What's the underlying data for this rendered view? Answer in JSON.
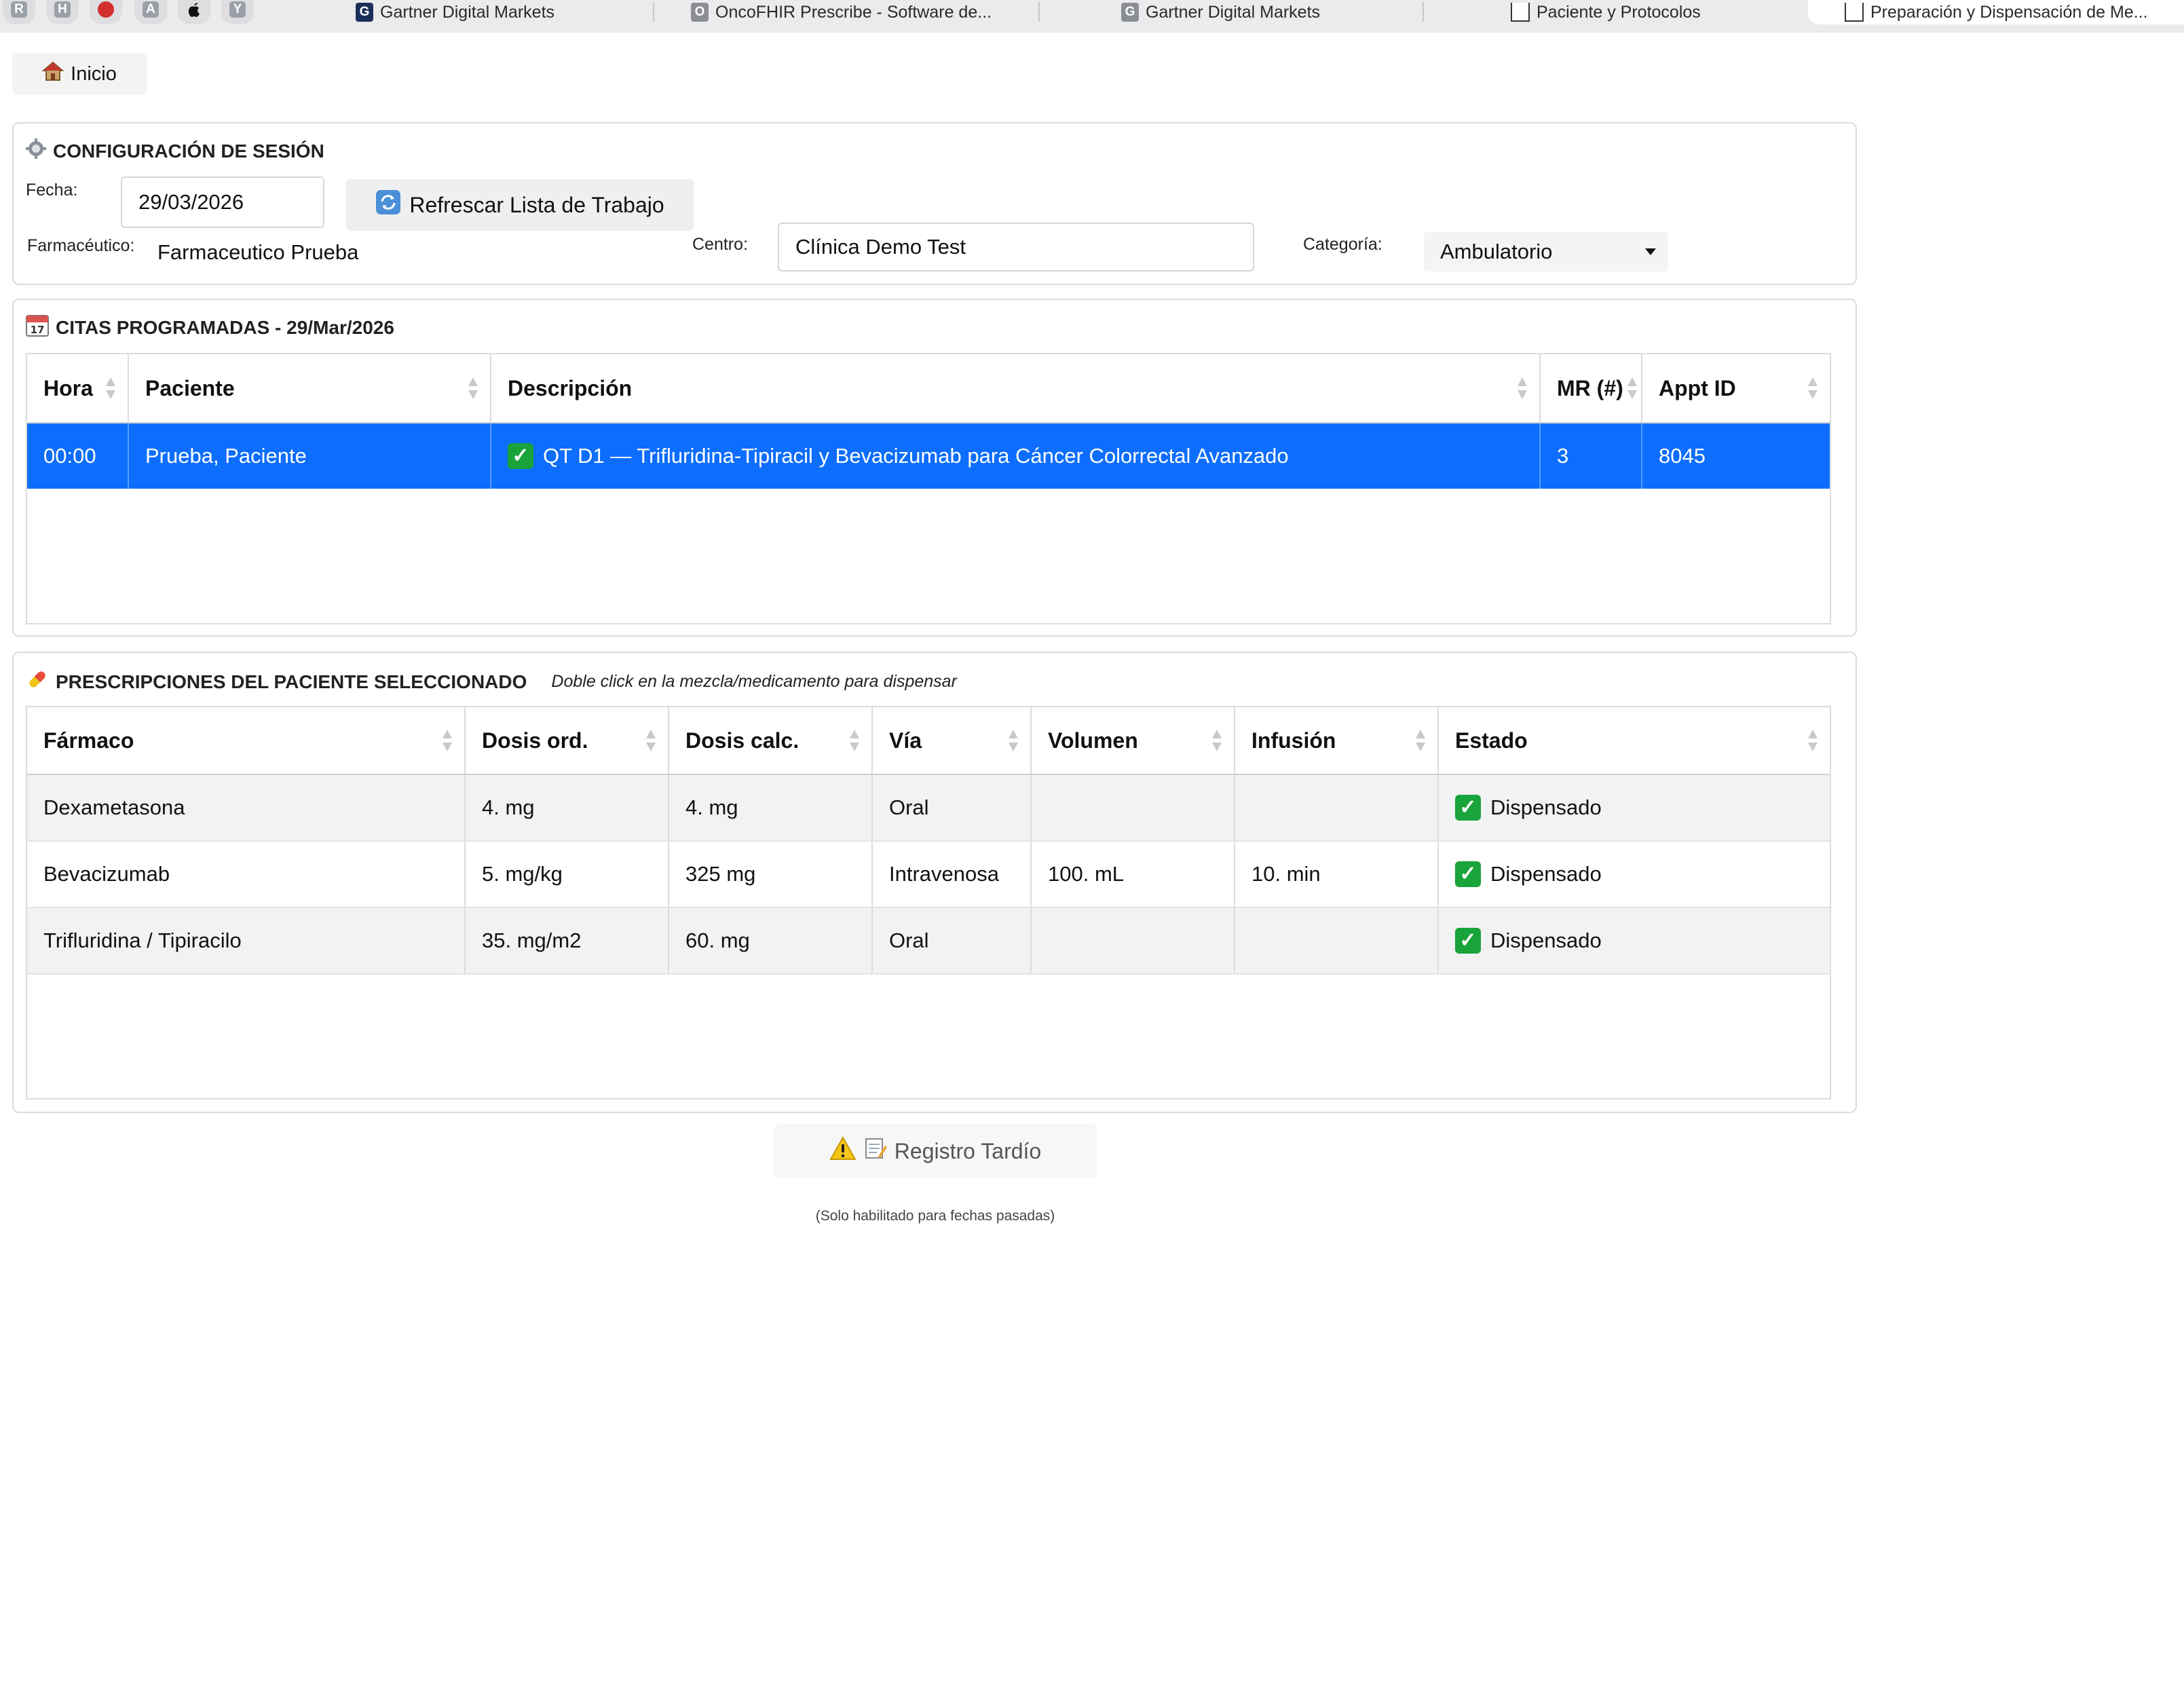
{
  "browser": {
    "pinned": [
      {
        "letter": "R",
        "color": "#8f97a3"
      },
      {
        "letter": "H",
        "color": "#8f97a3"
      },
      {
        "letter": "",
        "color": "#d32f2f"
      },
      {
        "letter": "A",
        "color": "#8f97a3"
      },
      {
        "letter": "",
        "color": "#111111"
      },
      {
        "letter": "Y",
        "color": "#8f97a3"
      }
    ],
    "tabs": [
      {
        "title": "Gartner Digital Markets",
        "favicon": "G"
      },
      {
        "title": "OncoFHIR Prescribe - Software de...",
        "favicon": "O"
      },
      {
        "title": "Gartner Digital Markets",
        "favicon": "G"
      },
      {
        "title": "Paciente y Protocolos",
        "favicon": ""
      },
      {
        "title": "Preparación y Dispensación de Me...",
        "favicon": ""
      }
    ]
  },
  "home": {
    "label": "Inicio",
    "icon": "house-icon"
  },
  "session": {
    "title": "CONFIGURACIÓN DE SESIÓN",
    "icon": "gear-icon",
    "date_label": "Fecha:",
    "date_value": "29/03/2026",
    "refresh_label": "Refrescar Lista de Trabajo",
    "pharmacist_label": "Farmacéutico:",
    "pharmacist_value": "Farmaceutico Prueba",
    "center_label": "Centro:",
    "center_value": "Clínica Demo Test",
    "category_label": "Categoría:",
    "category_value": "Ambulatorio"
  },
  "appointments": {
    "title": "CITAS PROGRAMADAS - 29/Mar/2026",
    "icon": "calendar-icon",
    "columns": [
      "Hora",
      "Paciente",
      "Descripción",
      "MR (#)",
      "Appt ID"
    ],
    "rows": [
      {
        "hora": "00:00",
        "paciente": "Prueba, Paciente",
        "descripcion": "QT D1 — Trifluridina-Tipiracil y Bevacizumab para Cáncer Colorrectal Avanzado",
        "mr": "3",
        "appt_id": "8045",
        "selected": true
      }
    ]
  },
  "prescriptions": {
    "title": "PRESCRIPCIONES DEL PACIENTE SELECCIONADO",
    "hint": "Doble click en la mezcla/medicamento para dispensar",
    "icon": "pill-icon",
    "columns": [
      "Fármaco",
      "Dosis ord.",
      "Dosis calc.",
      "Vía",
      "Volumen",
      "Infusión",
      "Estado"
    ],
    "rows": [
      {
        "farmaco": "Dexametasona",
        "dosis_ord": "4. mg",
        "dosis_calc": "4. mg",
        "via": "Oral",
        "volumen": "",
        "infusion": "",
        "estado": "Dispensado"
      },
      {
        "farmaco": "Bevacizumab",
        "dosis_ord": "5. mg/kg",
        "dosis_calc": "325 mg",
        "via": "Intravenosa",
        "volumen": "100. mL",
        "infusion": "10. min",
        "estado": "Dispensado"
      },
      {
        "farmaco": "Trifluridina / Tipiracilo",
        "dosis_ord": "35. mg/m2",
        "dosis_calc": "60. mg",
        "via": "Oral",
        "volumen": "",
        "infusion": "",
        "estado": "Dispensado"
      }
    ]
  },
  "late_registration": {
    "label": "Registro Tardío",
    "note": "(Solo habilitado para fechas pasadas)"
  },
  "colors": {
    "accent": "#0d6efd",
    "success": "#19a33b"
  }
}
